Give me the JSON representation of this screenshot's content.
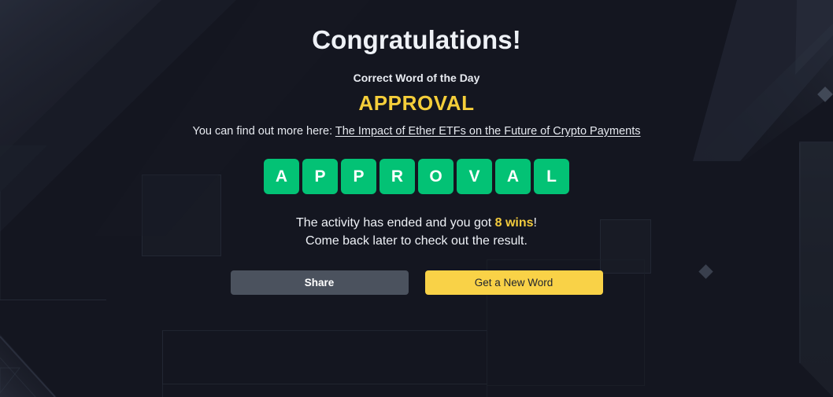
{
  "page": {
    "background_color": "#141620",
    "title": "Congratulations!"
  },
  "word_section": {
    "subtitle": "Correct Word of the Day",
    "word": "APPROVAL",
    "word_color": "#f5ce3a"
  },
  "link_section": {
    "prefix": "You can find out more here: ",
    "link_text": "The Impact of Ether ETFs on the Future of Crypto Payments"
  },
  "tiles": {
    "letters": [
      "A",
      "P",
      "P",
      "R",
      "O",
      "V",
      "A",
      "L"
    ],
    "tile_color": "#03c275",
    "letter_color": "#ffffff"
  },
  "result": {
    "line1_prefix": "The activity has ended and you got ",
    "line1_highlight": "8 wins",
    "line1_suffix": "!",
    "line2": "Come back later to check out the result.",
    "highlight_color": "#f3cb3d"
  },
  "buttons": {
    "share_label": "Share",
    "share_color": "#4b525e",
    "new_word_label": "Get a New Word",
    "new_word_color": "#f9d247"
  }
}
